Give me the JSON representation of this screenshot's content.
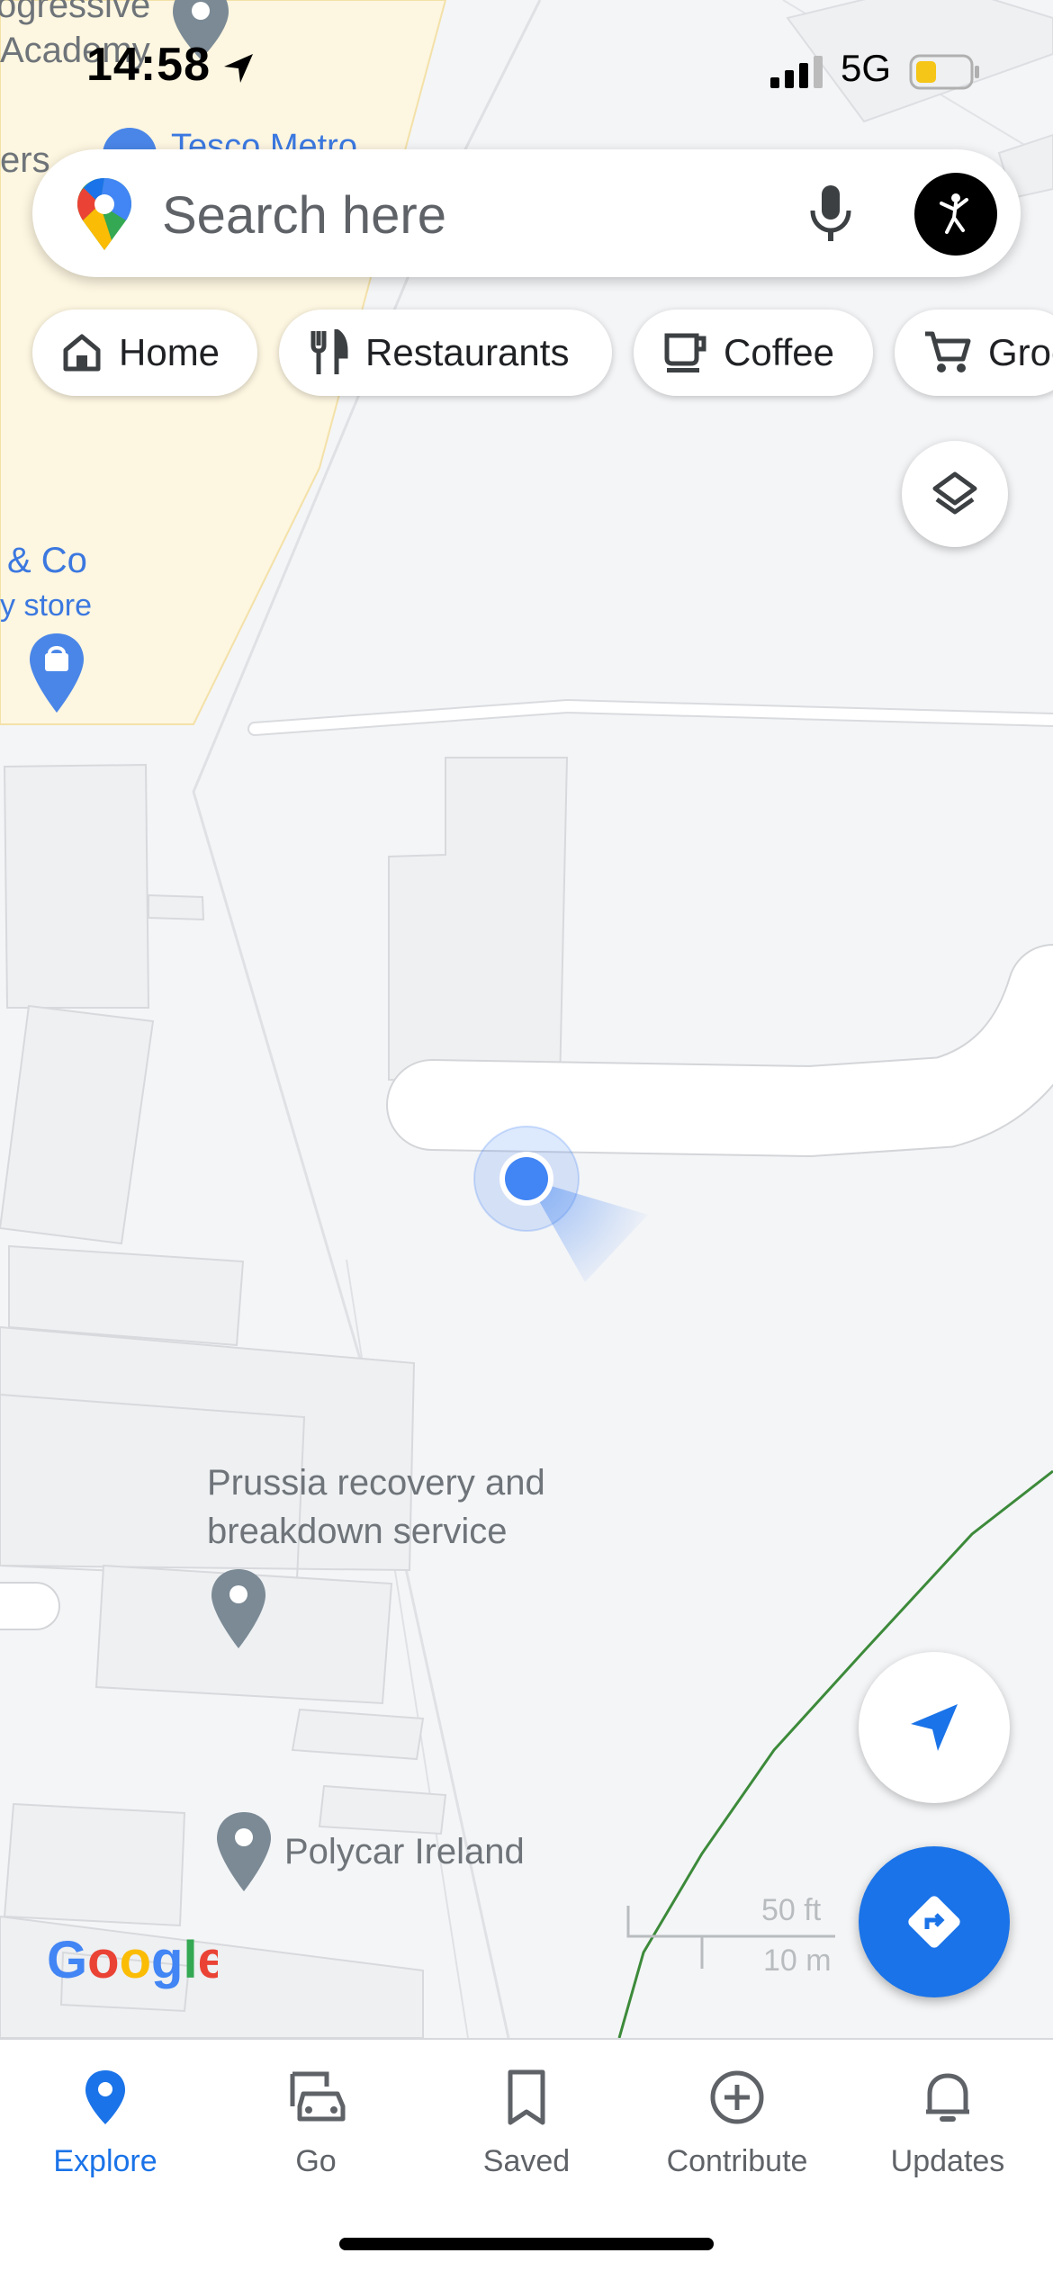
{
  "status_bar": {
    "time": "14:58",
    "network": "5G"
  },
  "search": {
    "placeholder": "Search here"
  },
  "chips": [
    {
      "label": "Home",
      "icon": "home-icon"
    },
    {
      "label": "Restaurants",
      "icon": "fork-knife-icon"
    },
    {
      "label": "Coffee",
      "icon": "coffee-cup-icon"
    },
    {
      "label": "Groceries",
      "icon": "shopping-cart-icon"
    }
  ],
  "map": {
    "labels": {
      "academy_1": "ogressive",
      "academy_2": "Academy",
      "left_edge": "ers",
      "tesco": "Tesco Metro",
      "store_1": "& Co",
      "store_2": "y store",
      "prussia_1": "Prussia recovery and",
      "prussia_2": "breakdown service",
      "polycar": "Polycar Ireland"
    },
    "scale": {
      "imperial": "50 ft",
      "metric": "10 m"
    },
    "attribution": "Google"
  },
  "colors": {
    "accent": "#1a73e8",
    "location_dot": "#4285f4",
    "pin_gray": "#7b8a95",
    "park_fill": "#fdf6e0"
  },
  "nav": [
    {
      "label": "Explore",
      "icon": "explore-pin-icon",
      "active": true
    },
    {
      "label": "Go",
      "icon": "car-icon",
      "active": false
    },
    {
      "label": "Saved",
      "icon": "bookmark-icon",
      "active": false
    },
    {
      "label": "Contribute",
      "icon": "plus-circle-icon",
      "active": false
    },
    {
      "label": "Updates",
      "icon": "bell-icon",
      "active": false
    }
  ]
}
